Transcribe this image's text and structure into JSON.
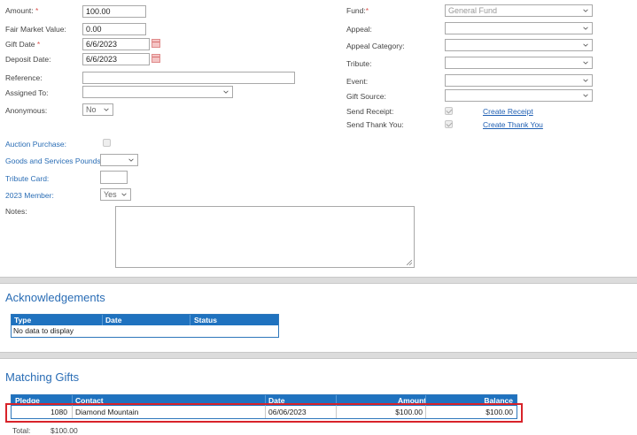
{
  "gift": {
    "amount_label": "Amount:",
    "amount_value": "100.00",
    "fmv_label": "Fair Market Value:",
    "fmv_value": "0.00",
    "gift_date_label": "Gift Date",
    "gift_date_value": "6/6/2023",
    "deposit_date_label": "Deposit Date:",
    "deposit_date_value": "6/6/2023",
    "reference_label": "Reference:",
    "reference_value": "",
    "assigned_label": "Assigned To:",
    "assigned_value": "",
    "anonymous_label": "Anonymous:",
    "anonymous_value": "No",
    "required_mark": "*",
    "colon": ":"
  },
  "right": {
    "fund_label": "Fund:",
    "fund_value": "General Fund",
    "appeal_label": "Appeal:",
    "appeal_category_label": "Appeal Category:",
    "tribute_label": "Tribute:",
    "event_label": "Event:",
    "gift_source_label": "Gift Source:",
    "send_receipt_label": "Send Receipt:",
    "send_receipt_link": "Create Receipt",
    "send_thanks_label": "Send Thank You:",
    "send_thanks_link": "Create Thank You"
  },
  "custom": {
    "auction_label": "Auction Purchase:",
    "goods_label": "Goods and Services Pounds:",
    "tribute_card_label": "Tribute Card:",
    "member_label": "2023 Member:",
    "member_value": "Yes",
    "notes_label": "Notes:"
  },
  "acknowledgements": {
    "title": "Acknowledgements",
    "columns": [
      "Type",
      "Date",
      "Status"
    ],
    "empty_text": "No data to display"
  },
  "matching": {
    "title": "Matching Gifts",
    "columns": [
      "Pledge",
      "Contact",
      "Date",
      "Amount",
      "Balance"
    ],
    "rows": [
      {
        "pledge": "1080",
        "contact": "Diamond Mountain",
        "date": "06/06/2023",
        "amount": "$100.00",
        "balance": "$100.00"
      }
    ],
    "total_label": "Total:",
    "total_value": "$100.00"
  },
  "colors": {
    "accent": "#2a6db5",
    "header": "#1f72bf",
    "highlight": "#d8232a",
    "required": "#d9534f"
  }
}
